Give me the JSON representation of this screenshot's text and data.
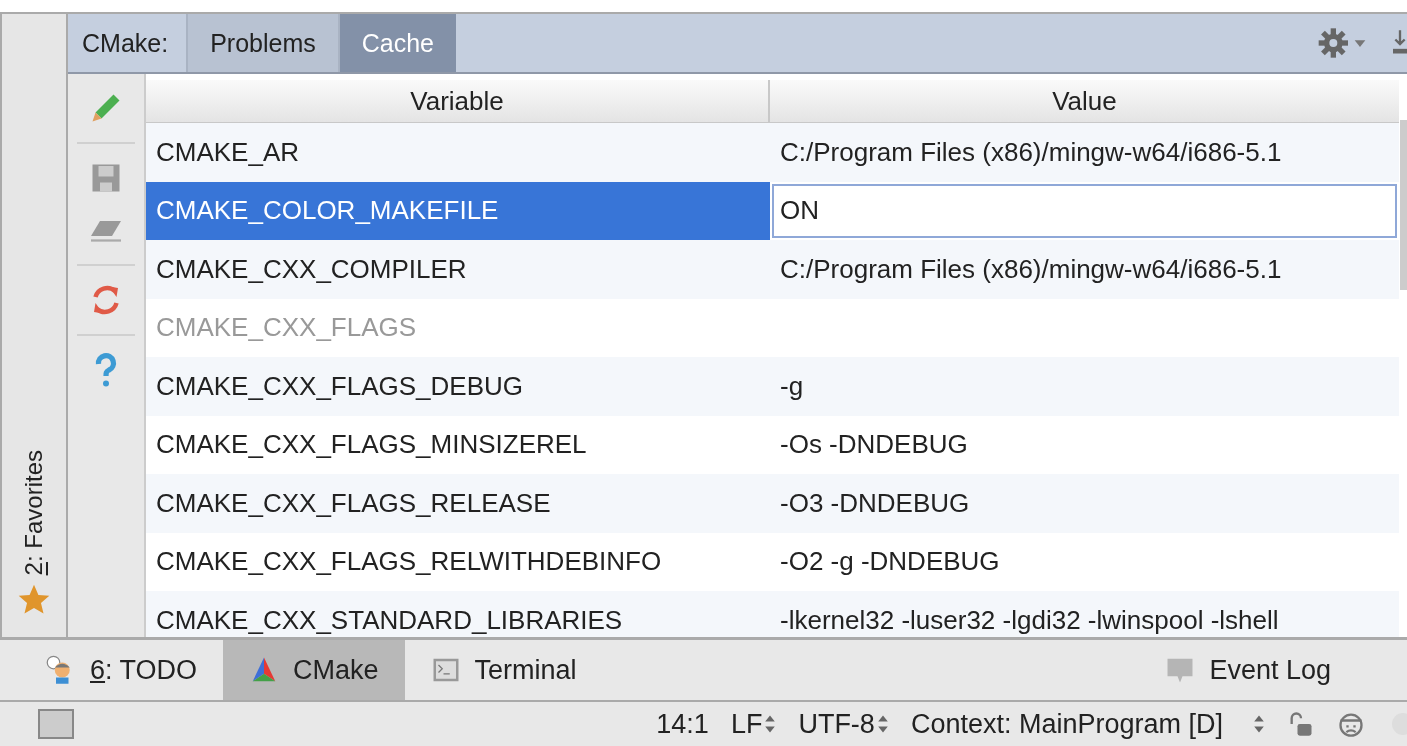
{
  "favorites_strip": {
    "mnemonic": "2",
    "label": ": Favorites"
  },
  "header": {
    "prefix": "CMake:",
    "tabs": [
      {
        "label": "Problems",
        "selected": false
      },
      {
        "label": "Cache",
        "selected": true
      }
    ]
  },
  "toolbar": [
    {
      "kind": "pencil"
    },
    {
      "kind": "divider"
    },
    {
      "kind": "save"
    },
    {
      "kind": "eraser"
    },
    {
      "kind": "divider"
    },
    {
      "kind": "reload"
    },
    {
      "kind": "divider"
    },
    {
      "kind": "help"
    }
  ],
  "table": {
    "columns": [
      "Variable",
      "Value"
    ],
    "rows": [
      {
        "variable": "CMAKE_AR",
        "value": "C:/Program Files (x86)/mingw-w64/i686-5.1",
        "selected": false,
        "dimmed": false,
        "editing": false
      },
      {
        "variable": "CMAKE_COLOR_MAKEFILE",
        "value": "ON",
        "selected": true,
        "dimmed": false,
        "editing": true
      },
      {
        "variable": "CMAKE_CXX_COMPILER",
        "value": "C:/Program Files (x86)/mingw-w64/i686-5.1",
        "selected": false,
        "dimmed": false,
        "editing": false
      },
      {
        "variable": "CMAKE_CXX_FLAGS",
        "value": "",
        "selected": false,
        "dimmed": true,
        "editing": false
      },
      {
        "variable": "CMAKE_CXX_FLAGS_DEBUG",
        "value": "-g",
        "selected": false,
        "dimmed": false,
        "editing": false
      },
      {
        "variable": "CMAKE_CXX_FLAGS_MINSIZEREL",
        "value": "-Os -DNDEBUG",
        "selected": false,
        "dimmed": false,
        "editing": false
      },
      {
        "variable": "CMAKE_CXX_FLAGS_RELEASE",
        "value": "-O3 -DNDEBUG",
        "selected": false,
        "dimmed": false,
        "editing": false
      },
      {
        "variable": "CMAKE_CXX_FLAGS_RELWITHDEBINFO",
        "value": "-O2 -g -DNDEBUG",
        "selected": false,
        "dimmed": false,
        "editing": false
      },
      {
        "variable": "CMAKE_CXX_STANDARD_LIBRARIES",
        "value": "-lkernel32 -luser32 -lgdi32 -lwinspool -lshell",
        "selected": false,
        "dimmed": false,
        "editing": false
      }
    ]
  },
  "tool_tabs": [
    {
      "kind": "todo",
      "mnemonic": "6",
      "label": ": TODO",
      "selected": false
    },
    {
      "kind": "cmake",
      "label": "CMake",
      "selected": true
    },
    {
      "kind": "terminal",
      "label": "Terminal",
      "selected": false
    }
  ],
  "event_log": "Event Log",
  "status_bar": {
    "position": "14:1",
    "line_separator": "LF",
    "encoding": "UTF-8",
    "context": "Context: MainProgram [D]"
  }
}
